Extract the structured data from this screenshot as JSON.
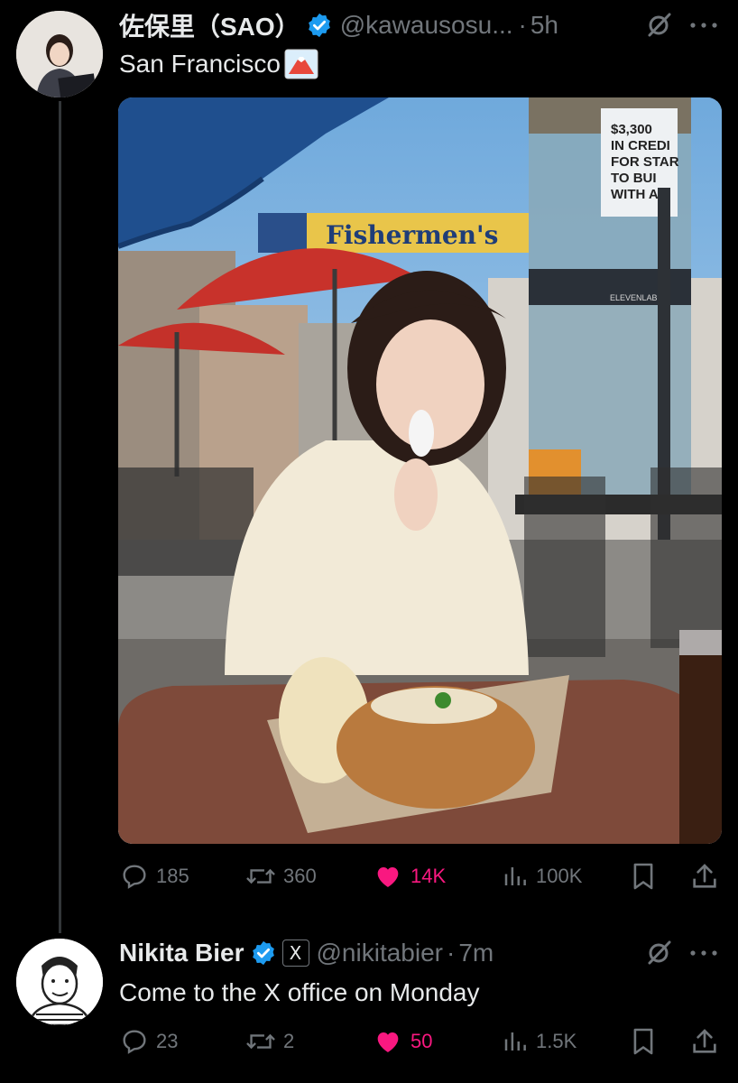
{
  "tweet": {
    "display_name": "佐保里（SAO）",
    "handle": "@kawausosu...",
    "separator": "·",
    "time": "5h",
    "text": "San Francisco",
    "media": {
      "banner_text": "Fishermen's",
      "kiosk_text": [
        "$3,300",
        "IN CREDI",
        "FOR STAR",
        "TO BUI",
        "WITH A"
      ],
      "kiosk_small": "ELEVENLAB"
    },
    "actions": {
      "replies": "185",
      "reposts": "360",
      "likes": "14K",
      "views": "100K"
    }
  },
  "reply": {
    "display_name": "Nikita Bier",
    "handle": "@nikitabier",
    "separator": "·",
    "time": "7m",
    "text": "Come to the X office on Monday",
    "affiliate_badge": "X",
    "actions": {
      "replies": "23",
      "reposts": "2",
      "likes": "50",
      "views": "1.5K"
    }
  },
  "colors": {
    "background": "#000000",
    "text_primary": "#e7e9ea",
    "text_secondary": "#71767b",
    "verified_blue": "#1d9bf0",
    "like_pink": "#f91880"
  }
}
